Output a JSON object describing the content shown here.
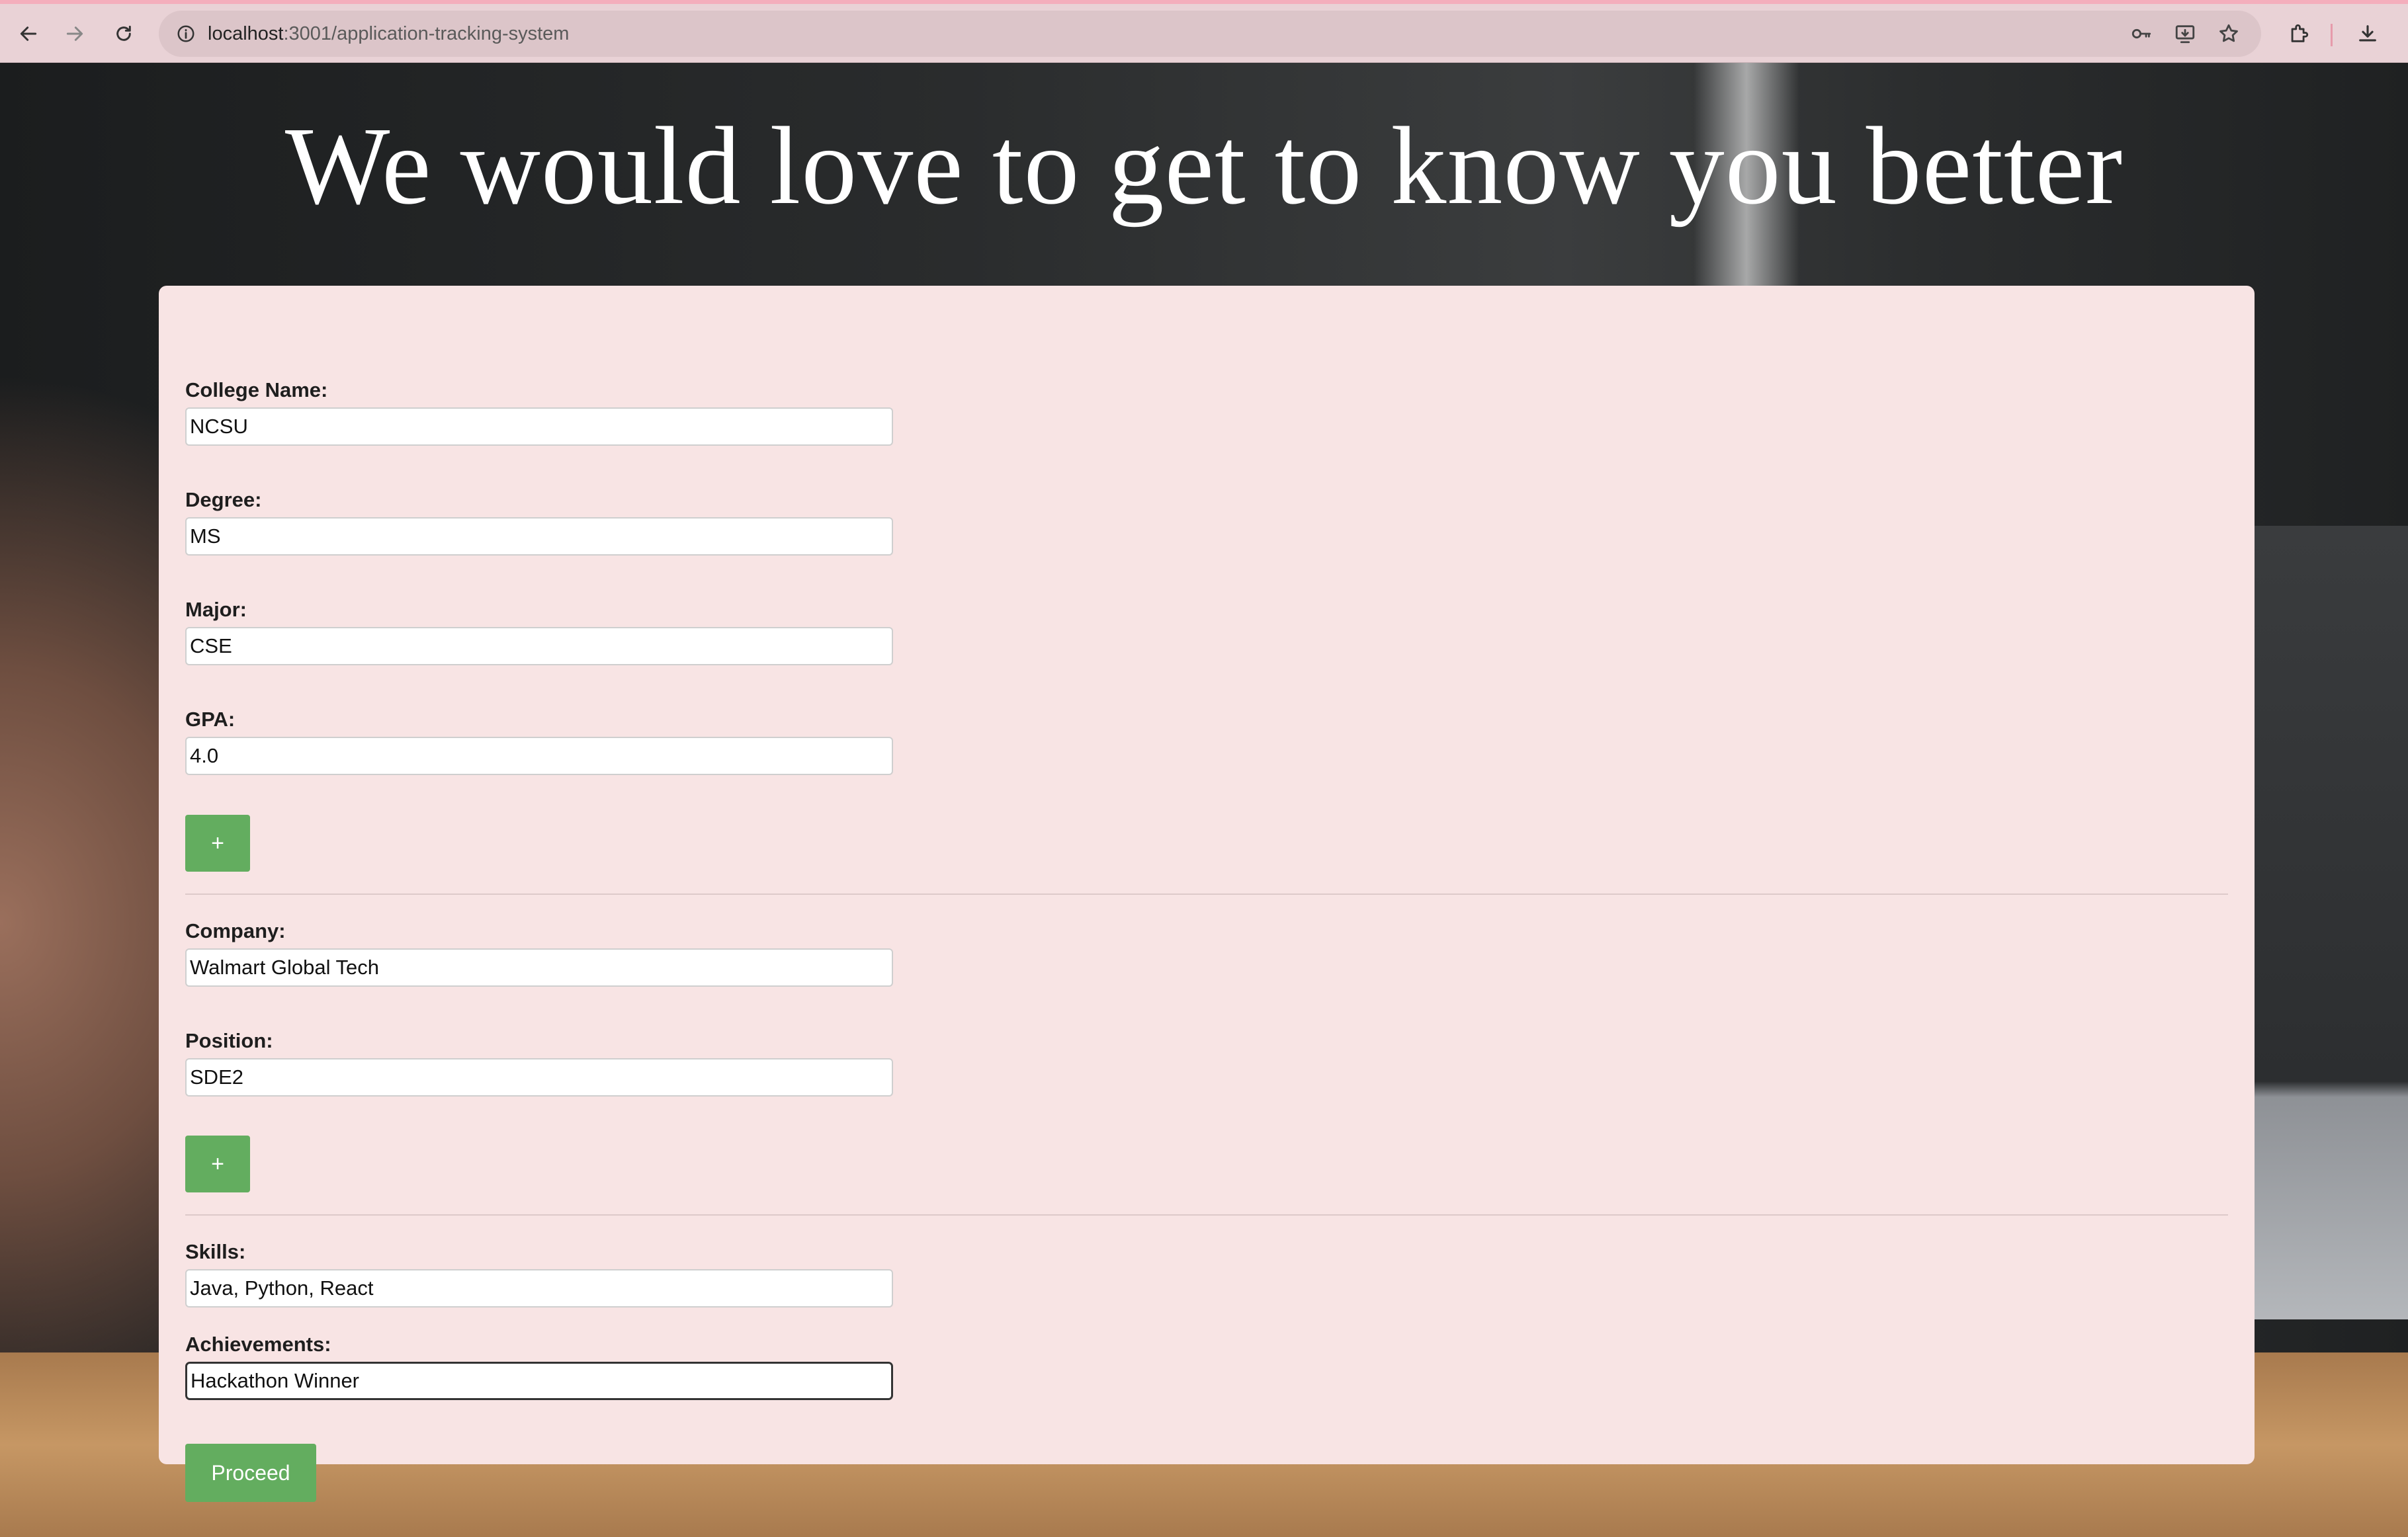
{
  "browser": {
    "url_host": "localhost",
    "url_path": ":3001/application-tracking-system"
  },
  "page": {
    "headline": "We would love to get to know you better"
  },
  "form": {
    "education": {
      "college_label": "College Name:",
      "college_value": "NCSU",
      "degree_label": "Degree:",
      "degree_value": "MS",
      "major_label": "Major:",
      "major_value": "CSE",
      "gpa_label": "GPA:",
      "gpa_value": "4.0",
      "add_label": "+"
    },
    "experience": {
      "company_label": "Company:",
      "company_value": "Walmart Global Tech",
      "position_label": "Position:",
      "position_value": "SDE2",
      "add_label": "+"
    },
    "skills_label": "Skills:",
    "skills_value": "Java, Python, React",
    "achievements_label": "Achievements:",
    "achievements_value": "Hackathon Winner",
    "proceed_label": "Proceed"
  },
  "colors": {
    "card_bg": "#f8e4e4",
    "button_green": "#63ad5f",
    "chrome_bg": "#e9d2d6"
  }
}
